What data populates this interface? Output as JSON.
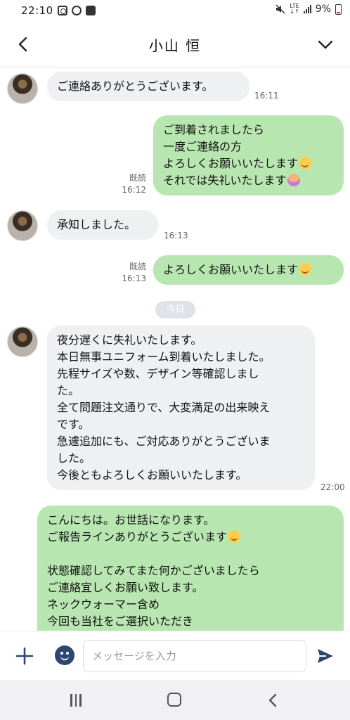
{
  "status": {
    "time": "22:10",
    "network": "LTE",
    "battery": "9%"
  },
  "header": {
    "title": "小山 恒"
  },
  "messages": [
    {
      "dir": "in",
      "text": "ご連絡ありがとうございます。",
      "time": "16:11"
    },
    {
      "dir": "out",
      "lines": [
        "ご到着されましたら",
        "一度ご連絡の方",
        "よろしくお願いいたします",
        "それでは失礼いたします"
      ],
      "read": "既読",
      "time": "16:12"
    },
    {
      "dir": "in",
      "text": "承知しました。",
      "time": "16:13"
    },
    {
      "dir": "out",
      "text": "よろしくお願いいたします",
      "read": "既読",
      "time": "16:13"
    },
    {
      "dir": "in",
      "text": "夜分遅くに失礼いたします。\n本日無事ユニフォーム到着いたしました。\n先程サイズや数、デザイン等確認しまし\nた。\n全て問題注文通りで、大変満足の出来映え\nです。\n急遽追加にも、ご対応ありがとうございま\nした。\n今後ともよろしくお願いいたします。",
      "time": "22:00"
    },
    {
      "dir": "out",
      "lines": [
        "こんにちは。お世話になります。",
        "ご報告ラインありがとうございます",
        "",
        "状態確認してみてまた何かございましたら",
        "ご連絡宜しくお願い致します。",
        "ネックウォーマー含め",
        "今回も当社をご選択いただき"
      ]
    }
  ],
  "date_chip": "今日",
  "input": {
    "placeholder": "メッセージを入力"
  },
  "icons": {
    "back": "chevron-left-icon",
    "menu": "chevron-down-icon",
    "plus": "plus-icon",
    "emoji": "emoji-icon",
    "send": "send-icon"
  },
  "colors": {
    "outgoing_bubble": "#b8e6b0",
    "incoming_bubble": "#eef0f2",
    "emoji_button": "#2f4770"
  }
}
